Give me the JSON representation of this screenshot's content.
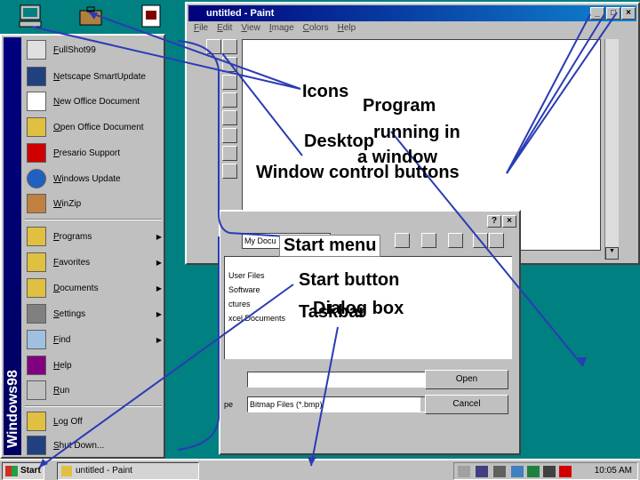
{
  "desktop": {
    "icons": [
      "my-computer-icon",
      "my-briefcase-icon",
      "my-documents-icon"
    ]
  },
  "paint": {
    "title": "untitled - Paint",
    "menus": [
      "File",
      "Edit",
      "View",
      "Image",
      "Colors",
      "Help"
    ],
    "controls": {
      "minimize": "_",
      "maximize": "□",
      "close": "×"
    }
  },
  "start_menu": {
    "banner": "Windows98",
    "top_items": [
      {
        "label": "FullShot99"
      },
      {
        "label": "Netscape SmartUpdate"
      },
      {
        "label": "New Office Document"
      },
      {
        "label": "Open Office Document"
      },
      {
        "label": "Presario Support"
      },
      {
        "label": "Windows Update"
      },
      {
        "label": "WinZip"
      }
    ],
    "main_items": [
      {
        "label": "Programs",
        "submenu": true
      },
      {
        "label": "Favorites",
        "submenu": true
      },
      {
        "label": "Documents",
        "submenu": true
      },
      {
        "label": "Settings",
        "submenu": true
      },
      {
        "label": "Find",
        "submenu": true
      },
      {
        "label": "Help",
        "submenu": false
      },
      {
        "label": "Run",
        "submenu": false
      }
    ],
    "bottom_items": [
      {
        "label": "Log Off"
      },
      {
        "label": "Shut Down..."
      }
    ]
  },
  "dialog": {
    "controls": {
      "help": "?",
      "close": "×"
    },
    "look_in_value": "My Docu",
    "files": [
      "User Files",
      "Software",
      "ctures",
      "xcel Documents"
    ],
    "file_type_label": "pe",
    "file_type_value": "Bitmap Files (*.bmp)",
    "open_button": "Open",
    "cancel_button": "Cancel"
  },
  "taskbar": {
    "start_label": "Start",
    "task_button": "untitled - Paint",
    "clock": "10:05 AM"
  },
  "annotations": {
    "icons": "Icons",
    "program": "Program",
    "running_in": "running in",
    "desktop": "Desktop",
    "a_window": "a window",
    "window_control_buttons": "Window control buttons",
    "start_menu": "Start menu",
    "start_button": "Start button",
    "dialog_box": "Dialog box",
    "taskbar": "Taskbar"
  },
  "colors": {
    "desktop": "#008080",
    "window_face": "#c0c0c0",
    "active_title": "#00007b",
    "annotation_line": "#2a3bb5"
  }
}
